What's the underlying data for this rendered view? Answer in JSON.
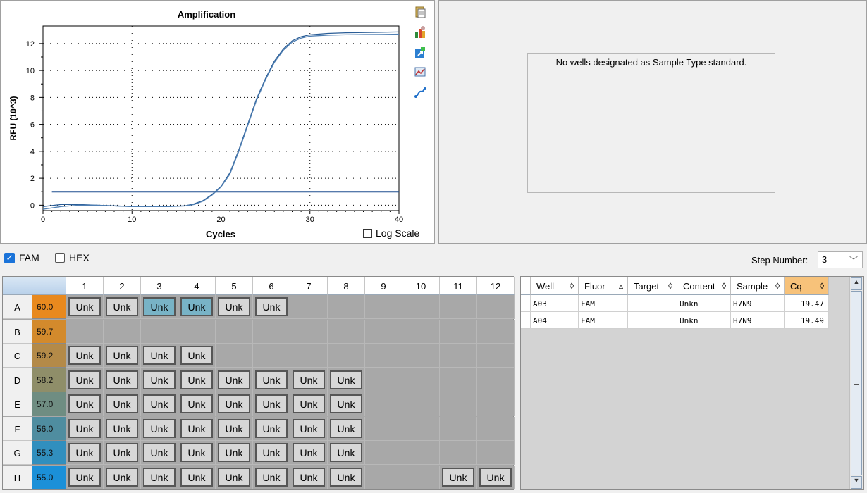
{
  "chart_data": {
    "type": "line",
    "title": "Amplification",
    "xlabel": "Cycles",
    "ylabel": "RFU (10^3)",
    "xlim": [
      0,
      40
    ],
    "ylim": [
      -0.4,
      13.3
    ],
    "x_ticks": [
      0,
      10,
      20,
      30,
      40
    ],
    "y_ticks": [
      0,
      2,
      4,
      6,
      8,
      10,
      12
    ],
    "grid": true,
    "threshold": 1.0,
    "series": [
      {
        "x": [
          0,
          2,
          4,
          6,
          8,
          10,
          12,
          14,
          16,
          17,
          18,
          19,
          20,
          21,
          22,
          23,
          24,
          25,
          26,
          27,
          28,
          29,
          30,
          32,
          34,
          36,
          38,
          40
        ],
        "values": [
          -0.1,
          0.05,
          0.05,
          0.0,
          -0.05,
          -0.1,
          -0.1,
          -0.1,
          -0.05,
          0.1,
          0.35,
          0.8,
          1.4,
          2.4,
          4.1,
          6.0,
          7.9,
          9.4,
          10.7,
          11.6,
          12.2,
          12.5,
          12.65,
          12.75,
          12.8,
          12.82,
          12.84,
          12.86
        ]
      },
      {
        "x": [
          0,
          2,
          4,
          6,
          8,
          10,
          12,
          14,
          16,
          17,
          18,
          19,
          20,
          21,
          22,
          23,
          24,
          25,
          26,
          27,
          28,
          29,
          30,
          32,
          34,
          36,
          38,
          40
        ],
        "values": [
          -0.3,
          -0.1,
          0.0,
          0.0,
          -0.05,
          -0.1,
          -0.1,
          -0.1,
          -0.05,
          0.05,
          0.3,
          0.75,
          1.35,
          2.3,
          4.0,
          5.9,
          7.8,
          9.3,
          10.6,
          11.5,
          12.1,
          12.4,
          12.55,
          12.62,
          12.65,
          12.67,
          12.68,
          12.7
        ]
      }
    ]
  },
  "chart_ui": {
    "log_scale_label": "Log Scale",
    "log_scale_checked": false
  },
  "toolbar_icons": [
    "copy-icon",
    "export-chart-icon",
    "export-icon",
    "chart-options-icon",
    "curve-fit-icon"
  ],
  "std_curve": {
    "message": "No wells designated as Sample Type standard."
  },
  "fluors": [
    {
      "label": "FAM",
      "checked": true
    },
    {
      "label": "HEX",
      "checked": false
    }
  ],
  "step": {
    "label": "Step Number:",
    "value": "3"
  },
  "plate": {
    "columns": [
      "1",
      "2",
      "3",
      "4",
      "5",
      "6",
      "7",
      "8",
      "9",
      "10",
      "11",
      "12"
    ],
    "rows": [
      {
        "label": "A",
        "temp": "60.0",
        "temp_color": "#e8891e",
        "wells": [
          "Unk",
          "Unk",
          "Unk*",
          "Unk*",
          "Unk",
          "Unk",
          "",
          "",
          "",
          "",
          "",
          ""
        ]
      },
      {
        "label": "B",
        "temp": "59.7",
        "temp_color": "#d38a2c",
        "wells": [
          "",
          "",
          "",
          "",
          "",
          "",
          "",
          "",
          "",
          "",
          "",
          ""
        ]
      },
      {
        "label": "C",
        "temp": "59.2",
        "temp_color": "#b48a48",
        "wells": [
          "Unk",
          "Unk",
          "Unk",
          "Unk",
          "",
          "",
          "",
          "",
          "",
          "",
          "",
          ""
        ]
      },
      {
        "label": "D",
        "temp": "58.2",
        "temp_color": "#8f8e69",
        "wells": [
          "Unk",
          "Unk",
          "Unk",
          "Unk",
          "Unk",
          "Unk",
          "Unk",
          "Unk",
          "",
          "",
          "",
          ""
        ]
      },
      {
        "label": "E",
        "temp": "57.0",
        "temp_color": "#6f8d82",
        "wells": [
          "Unk",
          "Unk",
          "Unk",
          "Unk",
          "Unk",
          "Unk",
          "Unk",
          "Unk",
          "",
          "",
          "",
          ""
        ]
      },
      {
        "label": "F",
        "temp": "56.0",
        "temp_color": "#4f8da0",
        "wells": [
          "Unk",
          "Unk",
          "Unk",
          "Unk",
          "Unk",
          "Unk",
          "Unk",
          "Unk",
          "",
          "",
          "",
          ""
        ]
      },
      {
        "label": "G",
        "temp": "55.3",
        "temp_color": "#318fbe",
        "wells": [
          "Unk",
          "Unk",
          "Unk",
          "Unk",
          "Unk",
          "Unk",
          "Unk",
          "Unk",
          "",
          "",
          "",
          ""
        ]
      },
      {
        "label": "H",
        "temp": "55.0",
        "temp_color": "#1b90d8",
        "wells": [
          "Unk",
          "Unk",
          "Unk",
          "Unk",
          "Unk",
          "Unk",
          "Unk",
          "Unk",
          "",
          "",
          "Unk",
          "Unk"
        ]
      }
    ]
  },
  "results": {
    "headers": [
      {
        "label": "Well",
        "sort": "◊"
      },
      {
        "label": "Fluor",
        "sort": "▵"
      },
      {
        "label": "Target",
        "sort": "◊"
      },
      {
        "label": "Content",
        "sort": "◊"
      },
      {
        "label": "Sample",
        "sort": "◊"
      },
      {
        "label": "Cq",
        "sort": "◊"
      }
    ],
    "rows": [
      [
        "A03",
        "FAM",
        "",
        "Unkn",
        "H7N9",
        "19.47"
      ],
      [
        "A04",
        "FAM",
        "",
        "Unkn",
        "H7N9",
        "19.49"
      ]
    ],
    "accent_color": "#f7c27a"
  }
}
